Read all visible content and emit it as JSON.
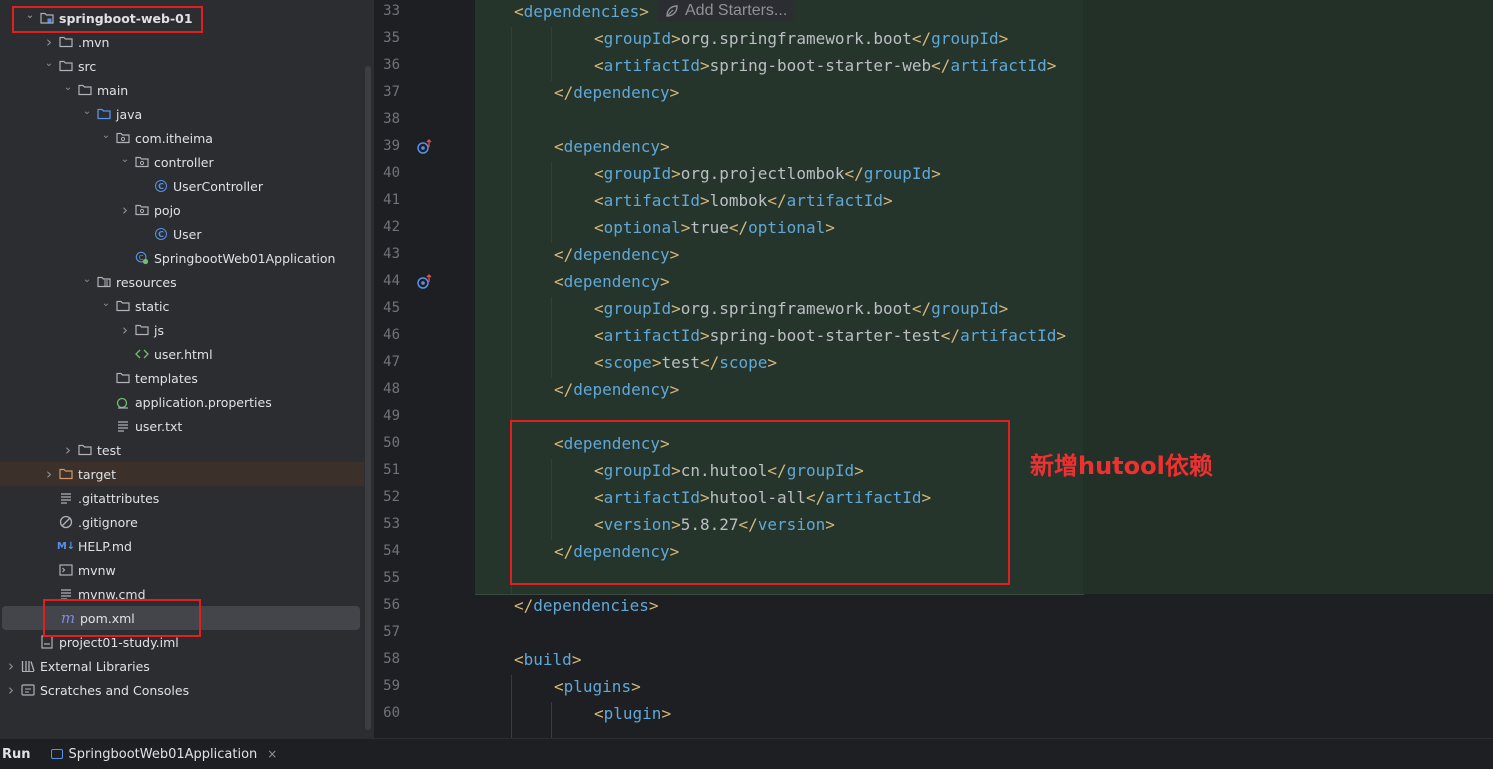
{
  "project_tree": {
    "items": [
      {
        "label": "springboot-web-01",
        "icon": "module-icon"
      },
      {
        "label": ".mvn",
        "icon": "folder-icon"
      },
      {
        "label": "src",
        "icon": "folder-icon"
      },
      {
        "label": "main",
        "icon": "folder-icon"
      },
      {
        "label": "java",
        "icon": "source-folder-icon"
      },
      {
        "label": "com.itheima",
        "icon": "package-icon"
      },
      {
        "label": "controller",
        "icon": "package-icon"
      },
      {
        "label": "UserController",
        "icon": "class-icon"
      },
      {
        "label": "pojo",
        "icon": "package-icon"
      },
      {
        "label": "User",
        "icon": "class-icon"
      },
      {
        "label": "SpringbootWeb01Application",
        "icon": "spring-app-icon"
      },
      {
        "label": "resources",
        "icon": "resources-folder-icon"
      },
      {
        "label": "static",
        "icon": "folder-icon"
      },
      {
        "label": "js",
        "icon": "folder-icon"
      },
      {
        "label": "user.html",
        "icon": "html-icon"
      },
      {
        "label": "templates",
        "icon": "folder-icon"
      },
      {
        "label": "application.properties",
        "icon": "properties-icon"
      },
      {
        "label": "user.txt",
        "icon": "text-file-icon"
      },
      {
        "label": "test",
        "icon": "folder-icon"
      },
      {
        "label": "target",
        "icon": "excluded-folder-icon"
      },
      {
        "label": ".gitattributes",
        "icon": "text-file-icon"
      },
      {
        "label": ".gitignore",
        "icon": "gitignore-icon"
      },
      {
        "label": "HELP.md",
        "icon": "markdown-icon"
      },
      {
        "label": "mvnw",
        "icon": "shell-icon"
      },
      {
        "label": "mvnw.cmd",
        "icon": "text-file-icon"
      },
      {
        "label": "pom.xml",
        "icon": "maven-icon"
      },
      {
        "label": "project01-study.iml",
        "icon": "iml-icon"
      },
      {
        "label": "External Libraries",
        "icon": "library-icon"
      },
      {
        "label": "Scratches and Consoles",
        "icon": "scratches-icon"
      }
    ]
  },
  "editor": {
    "inlay_hint": "Add Starters...",
    "line_numbers": [
      "33",
      "35",
      "36",
      "37",
      "38",
      "39",
      "40",
      "41",
      "42",
      "43",
      "44",
      "45",
      "46",
      "47",
      "48",
      "49",
      "50",
      "51",
      "52",
      "53",
      "54",
      "55",
      "56",
      "57",
      "58",
      "59",
      "60"
    ],
    "code": {
      "l33_open": "<",
      "l33_tag": "dependencies",
      "l33_close": ">",
      "group1": "org.springframework.boot",
      "artifact1": "spring-boot-starter-web",
      "group2": "org.projectlombok",
      "artifact2": "lombok",
      "optional2": "true",
      "group3": "org.springframework.boot",
      "artifact3": "spring-boot-starter-test",
      "scope3": "test",
      "group4": "cn.hutool",
      "artifact4": "hutool-all",
      "version4": "5.8.27",
      "tag_dependency": "dependency",
      "tag_groupId": "groupId",
      "tag_artifactId": "artifactId",
      "tag_optional": "optional",
      "tag_scope": "scope",
      "tag_version": "version",
      "tag_dependencies": "dependencies",
      "tag_build": "build",
      "tag_plugins": "plugins",
      "tag_plugin": "plugin"
    }
  },
  "annotation": {
    "note": "新增hutool依赖",
    "color": "#e02020"
  },
  "bottom_bar": {
    "run_label": "Run",
    "run_config": "SpringbootWeb01Application",
    "close": "×"
  }
}
